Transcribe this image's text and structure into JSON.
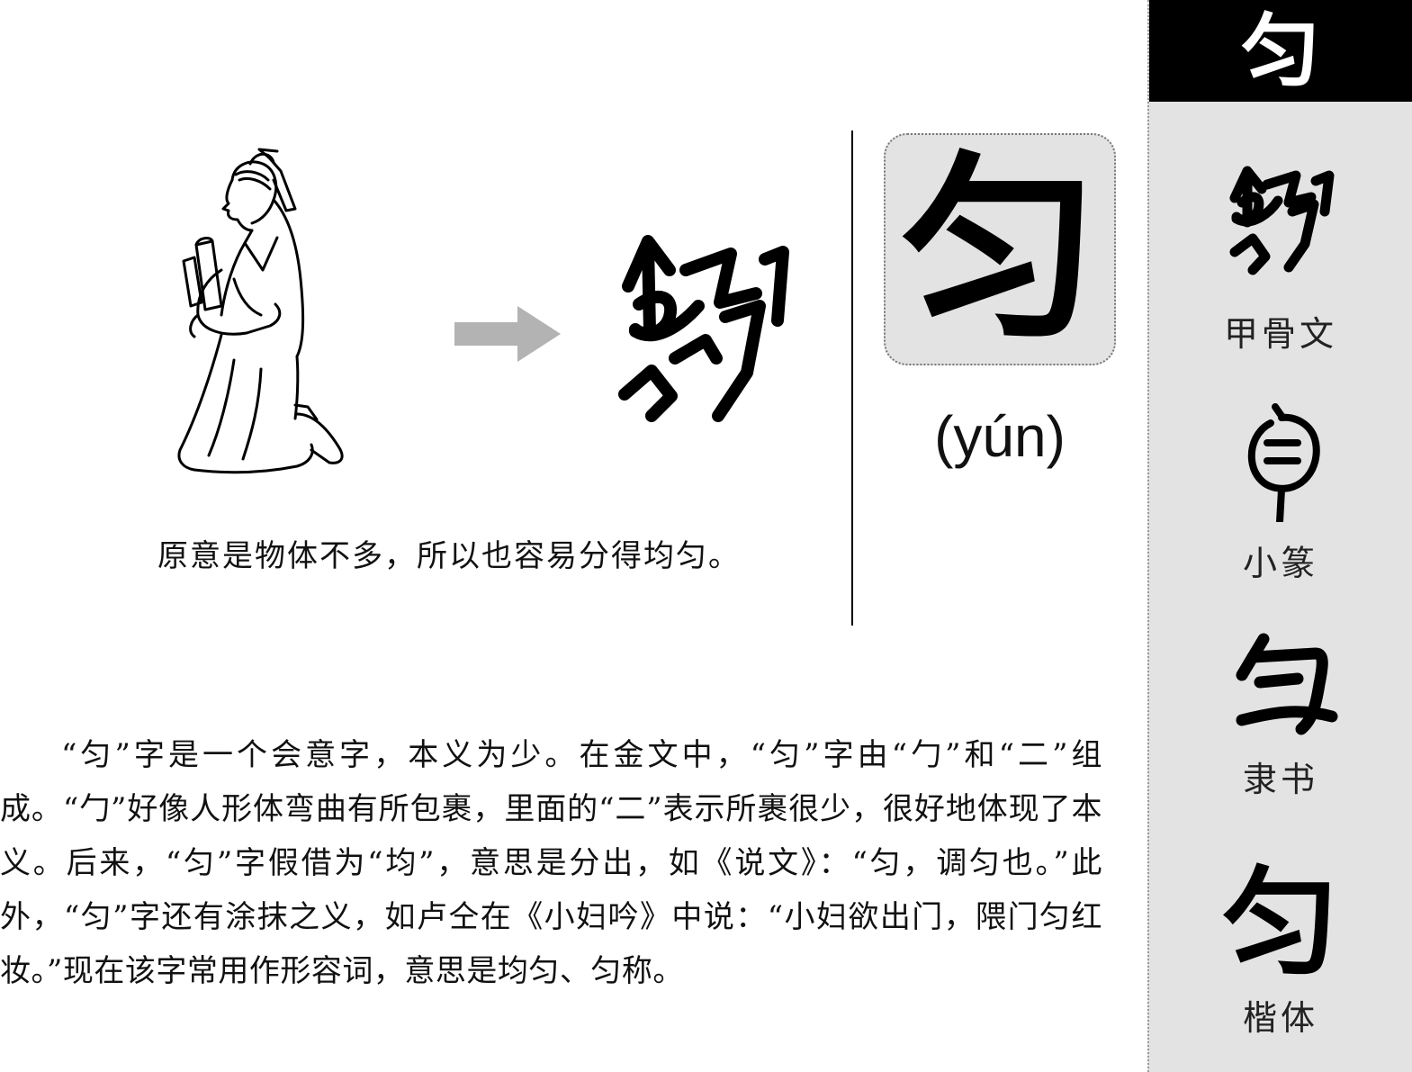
{
  "sidebar": {
    "header_char": "匀",
    "scripts": [
      {
        "label": "甲骨文",
        "icon": "oracle-bone-yun-icon"
      },
      {
        "label": "小篆",
        "icon": "small-seal-yun-icon"
      },
      {
        "label": "隶书",
        "icon": "clerical-yun-icon"
      },
      {
        "label": "楷体",
        "glyph": "匀"
      }
    ]
  },
  "main": {
    "caption": "原意是物体不多，所以也容易分得均匀。",
    "character": "匀",
    "pinyin": "(yún)",
    "body": "“匀”字是一个会意字，本义为少。在金文中，“匀”字由“勹”和“二”组成。“勹”好像人形体弯曲有所包裹，里面的“二”表示所裹很少，很好地体现了本义。后来，“匀”字假借为“均”，意思是分出，如《说文》：“匀，调匀也。”此外，“匀”字还有涂抹之义，如卢仝在《小妇吟》中说：“小妇欲出门，隈门匀红妆。”现在该字常用作形容词，意思是均匀、匀称。"
  },
  "colors": {
    "sidebar_bg": "#e3e3e3",
    "header_bg": "#000000",
    "arrow": "#b3b3b3"
  }
}
